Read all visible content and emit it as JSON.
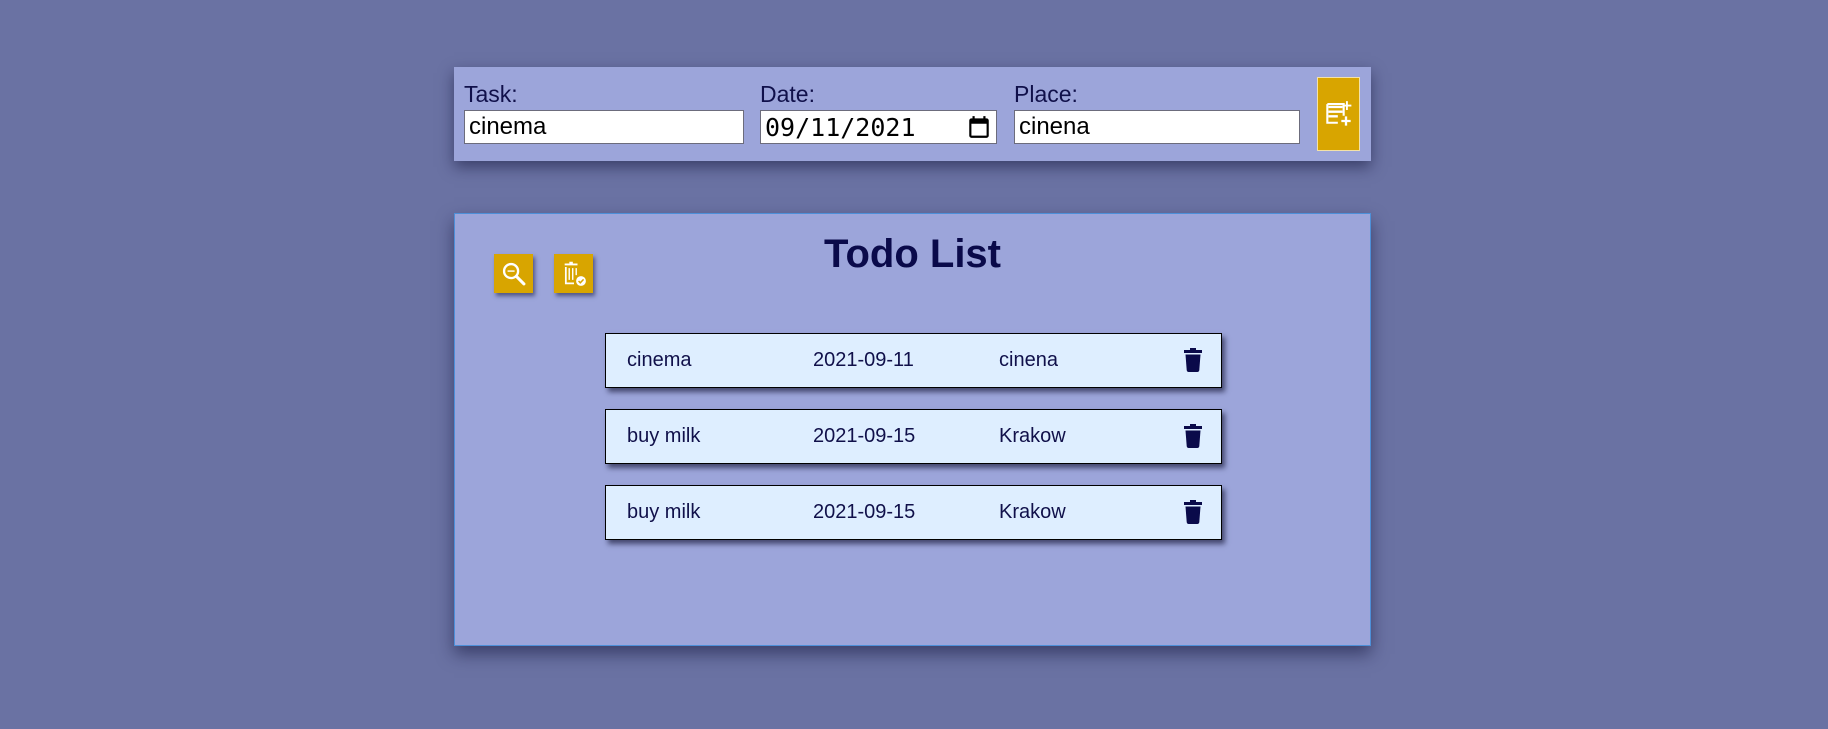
{
  "form": {
    "task_label": "Task:",
    "task_value": "cinema",
    "date_label": "Date:",
    "date_value": "09/11/2021",
    "place_label": "Place:",
    "place_value": "cinena",
    "add_button_icon": "note-add-icon"
  },
  "panel": {
    "title": "Todo List",
    "search_button_icon": "search-icon",
    "clear_done_button_icon": "delete-sweep-check-icon"
  },
  "todos": [
    {
      "task": "cinema",
      "date": "2021-09-11",
      "place": "cinena",
      "delete_icon": "trash-icon"
    },
    {
      "task": "buy milk",
      "date": "2021-09-15",
      "place": "Krakow",
      "delete_icon": "trash-icon"
    },
    {
      "task": "buy milk",
      "date": "2021-09-15",
      "place": "Krakow",
      "delete_icon": "trash-icon"
    }
  ],
  "colors": {
    "background": "#6a72a3",
    "panel": "#9ca5da",
    "accent": "#d8a500",
    "row": "#deeeff",
    "text": "#0a0a4a"
  }
}
